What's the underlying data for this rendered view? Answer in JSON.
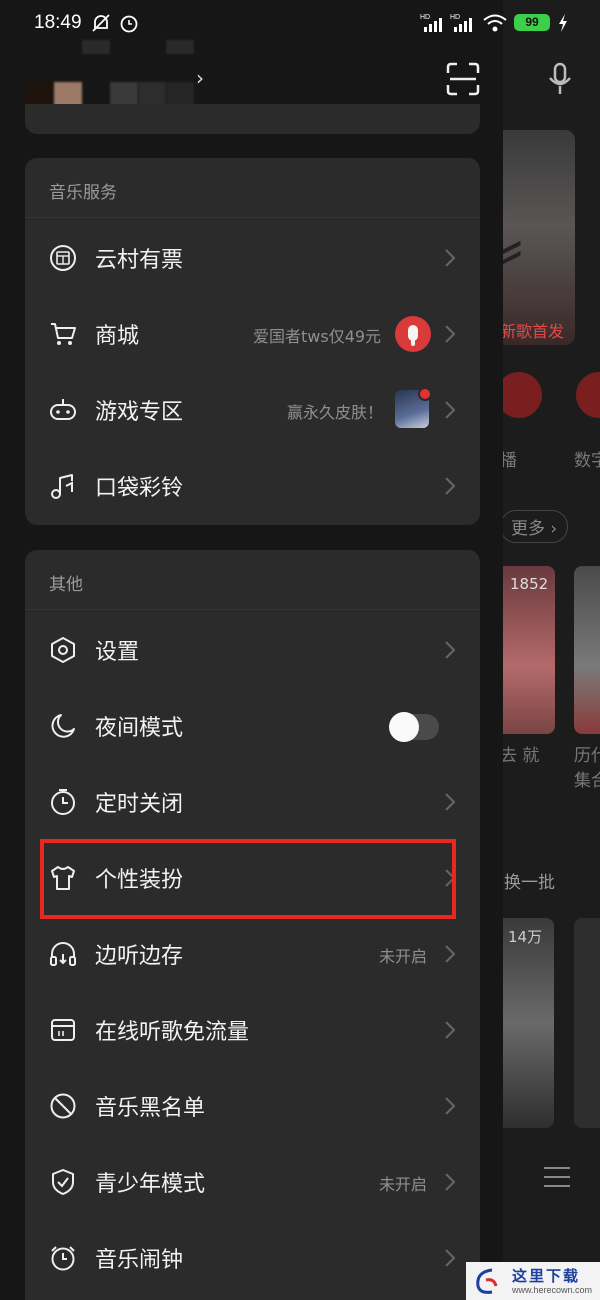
{
  "status_bar": {
    "time": "18:49",
    "battery": "99",
    "signal_1_label": "HD",
    "signal_2_label": "HD"
  },
  "header": {
    "scan_icon": "scan-icon"
  },
  "music_services": {
    "title": "音乐服务",
    "items": [
      {
        "label": "云村有票",
        "icon": "ticket-icon"
      },
      {
        "label": "商城",
        "icon": "cart-icon",
        "hint": "爱国者tws仅49元"
      },
      {
        "label": "游戏专区",
        "icon": "gamepad-icon",
        "hint": "赢永久皮肤！"
      },
      {
        "label": "口袋彩铃",
        "icon": "music-note-icon"
      }
    ]
  },
  "others": {
    "title": "其他",
    "items": [
      {
        "label": "设置",
        "icon": "settings-hexagon-icon"
      },
      {
        "label": "夜间模式",
        "icon": "moon-icon",
        "toggle_on": false
      },
      {
        "label": "定时关闭",
        "icon": "timer-icon"
      },
      {
        "label": "个性装扮",
        "icon": "tshirt-icon"
      },
      {
        "label": "边听边存",
        "icon": "headphones-download-icon",
        "hint": "未开启"
      },
      {
        "label": "在线听歌免流量",
        "icon": "sim-card-icon"
      },
      {
        "label": "音乐黑名单",
        "icon": "block-icon"
      },
      {
        "label": "青少年模式",
        "icon": "shield-check-icon",
        "hint": "未开启"
      },
      {
        "label": "音乐闹钟",
        "icon": "alarm-icon"
      }
    ]
  },
  "background_app": {
    "banner_tag": "新歌首发",
    "nav_label_1": "播",
    "nav_label_2": "数字",
    "more_label": "更多",
    "card_count": "1852",
    "card_caption_1": "去 就",
    "card_caption_2a": "历代",
    "card_caption_2b": "集合",
    "refresh_label": "换一批",
    "play_count": "14万"
  },
  "watermark": {
    "text": "这里下载",
    "url": "www.herecown.com"
  },
  "colors": {
    "highlight": "#e8281f",
    "battery": "#3ccf4a",
    "card_bg": "#2b2b2b"
  }
}
